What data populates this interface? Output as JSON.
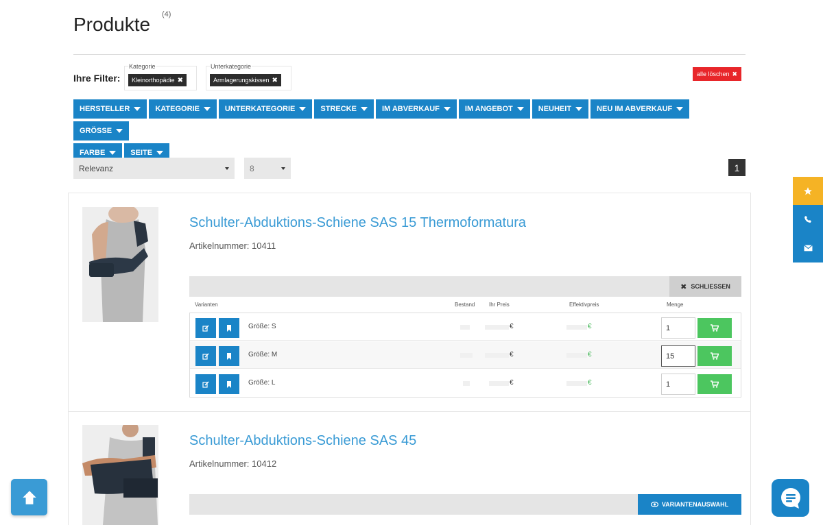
{
  "header": {
    "title": "Produkte",
    "count": "(4)"
  },
  "filters": {
    "label": "Ihre Filter:",
    "groups": [
      {
        "title": "Kategorie",
        "chip": "Kleinorthopädie"
      },
      {
        "title": "Unterkategorie",
        "chip": "Armlagerungskissen"
      }
    ],
    "clear_all": "alle löschen"
  },
  "facets": [
    "HERSTELLER",
    "KATEGORIE",
    "UNTERKATEGORIE",
    "STRECKE",
    "IM ABVERKAUF",
    "IM ANGEBOT",
    "NEUHEIT",
    "NEU IM ABVERKAUF",
    "GRÖSSE",
    "FARBE",
    "SEITE"
  ],
  "sorting": {
    "sort_value": "Relevanz",
    "per_page": "8"
  },
  "pagination": {
    "current": "1"
  },
  "products": [
    {
      "title": "Schulter-Abduktions-Schiene SAS 15 Thermoformatura",
      "article_label": "Artikelnummer: 10411",
      "close_label": "SCHLIESSEN",
      "variant_headers": {
        "variants": "Varianten",
        "stock": "Bestand",
        "your_price": "Ihr Preis",
        "effective_price": "Effektivpreis",
        "quantity": "Menge"
      },
      "variants": [
        {
          "label": "Größe: S",
          "price_symbol": "€",
          "eff_symbol": "€",
          "qty": "1"
        },
        {
          "label": "Größe: M",
          "price_symbol": "€",
          "eff_symbol": "€",
          "qty": "15"
        },
        {
          "label": "Größe: L",
          "price_symbol": "€",
          "eff_symbol": "€",
          "qty": "1"
        }
      ]
    },
    {
      "title": "Schulter-Abduktions-Schiene SAS 45",
      "article_label": "Artikelnummer: 10412",
      "variant_button": "VARIANTENAUSWAHL"
    }
  ],
  "side_actions": [
    {
      "icon": "star-icon",
      "color": "#f5b325"
    },
    {
      "icon": "phone-icon",
      "color": "#1a84c7"
    },
    {
      "icon": "mail-icon",
      "color": "#1a84c7"
    }
  ],
  "colors": {
    "primary": "#1a84c7",
    "link": "#3a9bd5",
    "danger": "#e8262a",
    "cart": "#4cc65f",
    "accent": "#f5b325"
  }
}
